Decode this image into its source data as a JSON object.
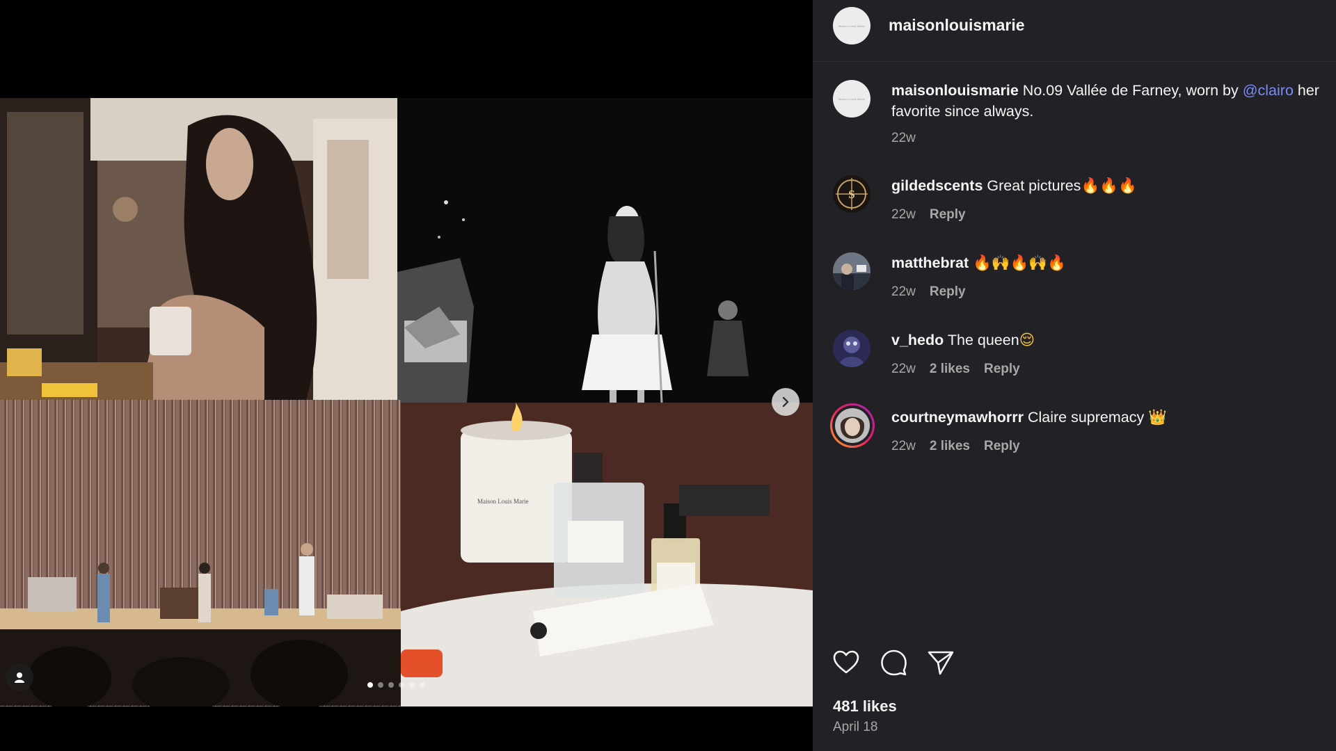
{
  "post": {
    "username": "maisonlouismarie",
    "avatar_text": "Maison Louis Marie",
    "caption": {
      "username": "maisonlouismarie",
      "text_before": " No.09 Vallée de Farney, worn by ",
      "mention": "@clairo",
      "text_after": " her favorite since always.",
      "time": "22w"
    },
    "likes": "481 likes",
    "date": "April 18",
    "carousel": {
      "total": 6,
      "current": 1
    }
  },
  "comments": [
    {
      "username": "gildedscents",
      "text": " Great pictures",
      "emoji": "🔥🔥🔥",
      "time": "22w",
      "likes": "",
      "reply": "Reply"
    },
    {
      "username": "matthebrat",
      "text": " ",
      "emoji": "🔥🙌🔥🙌🔥",
      "time": "22w",
      "likes": "",
      "reply": "Reply"
    },
    {
      "username": "v_hedo",
      "text": " The queen",
      "emoji": "😌",
      "time": "22w",
      "likes": "2 likes",
      "reply": "Reply"
    },
    {
      "username": "courtneymawhorrr",
      "text": " Claire supremacy ",
      "emoji": "👑",
      "time": "22w",
      "likes": "2 likes",
      "reply": "Reply"
    }
  ],
  "icons": {
    "like": "heart-icon",
    "comment": "comment-icon",
    "share": "send-icon",
    "next": "chevron-right-icon",
    "tag": "user-tag-icon"
  },
  "colors": {
    "panel_bg": "#212126",
    "mention": "#7c8cf2",
    "secondary_text": "#a8a8a8"
  }
}
